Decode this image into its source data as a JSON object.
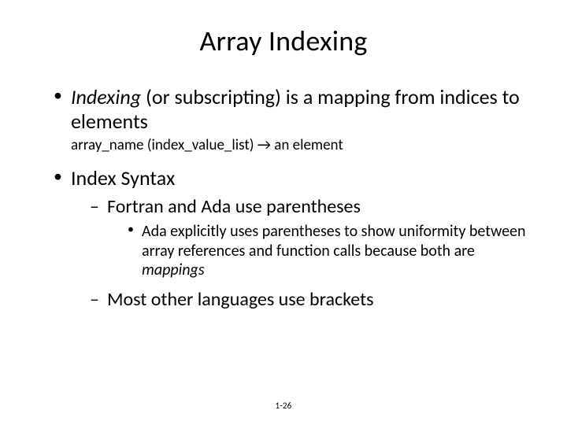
{
  "title": "Array Indexing",
  "bullets": {
    "b1": {
      "italicTerm": "Indexing",
      "rest": " (or subscripting) is a mapping from indices to elements",
      "note_pre": "array_name (index_value_list) ",
      "note_arrow": "→",
      "note_post": "  an element"
    },
    "b2": {
      "text": "Index Syntax",
      "sub1": {
        "text": "Fortran and Ada use parentheses",
        "sub": {
          "pre": "Ada explicitly uses parentheses to show uniformity between array references and function calls because both are ",
          "italic": "mappings"
        }
      },
      "sub2": {
        "text": "Most other languages use brackets"
      }
    }
  },
  "footer": "1-26"
}
